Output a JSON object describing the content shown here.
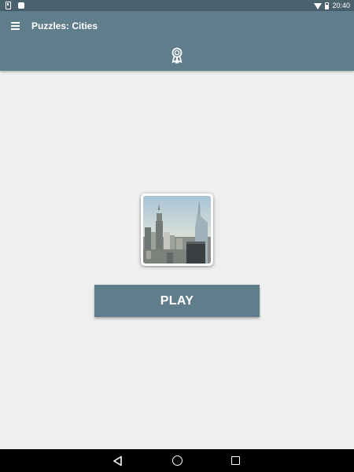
{
  "status_bar": {
    "time": "20:40",
    "icons": [
      "sim-icon",
      "android-icon",
      "wifi-icon",
      "battery-icon"
    ]
  },
  "app_bar": {
    "title": "Puzzles: Cities",
    "menu_icon": "hamburger-menu-icon",
    "action_icon": "award-ribbon-icon",
    "background_color": "#607d8b"
  },
  "main": {
    "puzzle_thumbnail": "city-skyline-photo",
    "play_label": "PLAY",
    "button_color": "#607d8b"
  },
  "nav_bar": {
    "icons": [
      "back-icon",
      "home-icon",
      "recent-apps-icon"
    ]
  },
  "colors": {
    "status_bar": "#4a616e",
    "background": "#efefef",
    "nav_bar": "#000000"
  }
}
